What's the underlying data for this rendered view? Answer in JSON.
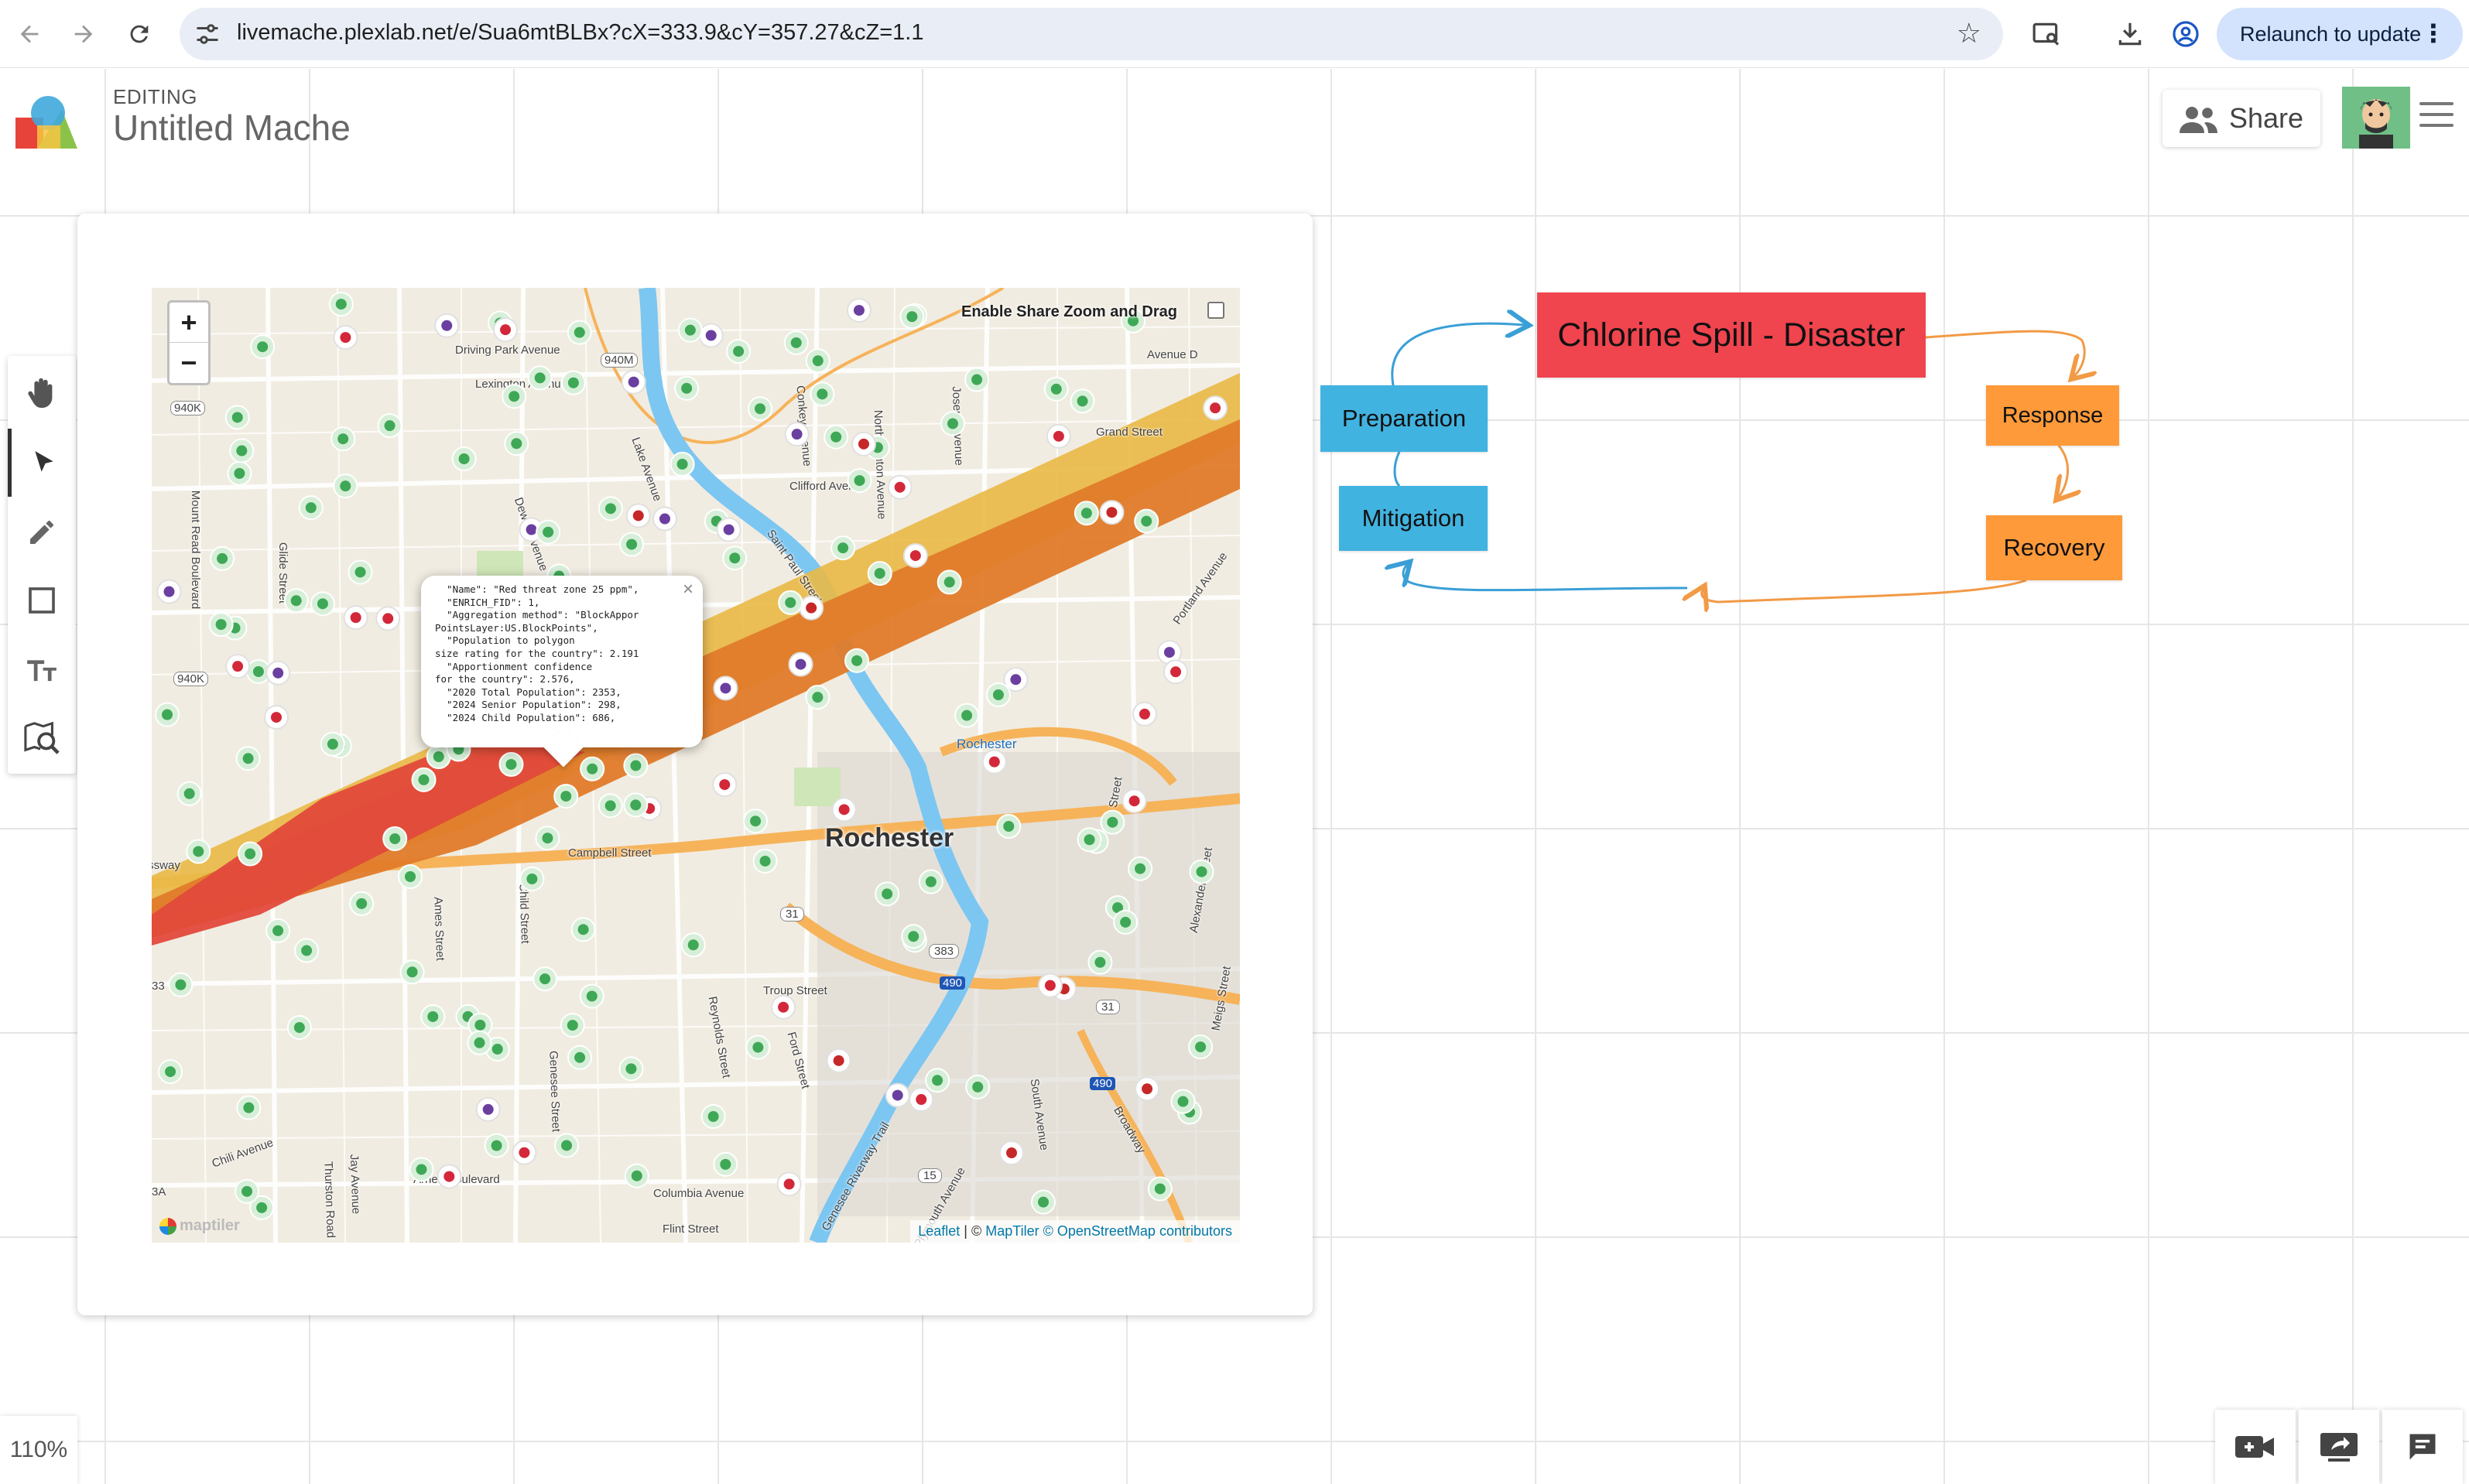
{
  "browser": {
    "url": "livemache.plexlab.net/e/Sua6mtBLBx?cX=333.9&cY=357.27&cZ=1.1",
    "relaunch_label": "Relaunch to update"
  },
  "app": {
    "mode_label": "EDITING",
    "doc_title": "Untitled Mache",
    "share_label": "Share",
    "zoom_level": "110%"
  },
  "toolbar": {
    "tools": [
      "hand-icon",
      "pointer-icon",
      "pencil-icon",
      "rectangle-icon",
      "text-icon",
      "map-search-icon"
    ],
    "active_tool": "pointer-icon"
  },
  "map": {
    "zoom_in": "+",
    "zoom_out": "−",
    "enable_share_label": "Enable Share Zoom and Drag",
    "city": "Rochester",
    "station": "Rochester",
    "attribution_leaflet": "Leaflet",
    "attribution_sep": " | © ",
    "attribution_maptiler": "MapTiler",
    "attribution_osm": "© OpenStreetMap contributors",
    "maptiler_logo": "maptiler",
    "plume_colors": {
      "outer": "#e9b945",
      "middle": "#e07b2a",
      "inner": "#e24a3b"
    },
    "streets": {
      "s1": "Driving Park Avenue",
      "s2": "Lexington Avenue",
      "s3": "Mount Read Boulevard",
      "s4": "Glide Street",
      "s5": "Dewey Avenue",
      "s6": "Lake Avenue",
      "s7": "Conkey Avenue",
      "s8": "North Clinton Avenue",
      "s9": "Joseph Avenue",
      "s10": "Clifford Avenue",
      "s11": "Saint Paul Street",
      "s12": "Avenue D",
      "s13": "Campbell Street",
      "s14": "Ames Street",
      "s15": "Child Street",
      "s16": "Troup Street",
      "s17": "Reynolds Street",
      "s18": "Ford Street",
      "s19": "Genesee Street",
      "s20": "Arnett Boulevard",
      "s21": "Columbia Avenue",
      "s22": "Flint Street",
      "s23": "Genesee Riverway Trail",
      "s24": "South Avenue",
      "s25": "Broadway",
      "s26": "Alexander Street",
      "s27": "Scio Street",
      "s28": "Meigs Street",
      "s29": "Thurston Road",
      "s30": "Chili Avenue",
      "s31": "Portland Avenue",
      "s32": "Grand Street",
      "s33": "Expressway",
      "s34": "Jay Avenue",
      "s35": "Plymouth Avenue"
    },
    "route_shields": [
      "940M",
      "940K",
      "940K",
      "31",
      "383",
      "490",
      "490",
      "31",
      "15",
      "33",
      "3A"
    ],
    "popup_text": "  \"Name\": \"Red threat zone 25 ppm\",\n  \"ENRICH_FID\": 1,\n  \"Aggregation method\": \"BlockAppor\nPointsLayer:US.BlockPoints\",\n  \"Population to polygon\nsize rating for the country\": 2.191\n  \"Apportionment confidence\nfor the country\": 2.576,\n  \"2020 Total Population\": 2353,\n  \"2024 Senior Population\": 298,\n  \"2024 Child Population\": 686,",
    "popup_close": "×"
  },
  "diagram": {
    "disaster": "Chlorine Spill - Disaster",
    "preparation": "Preparation",
    "mitigation": "Mitigation",
    "response": "Response",
    "recovery": "Recovery",
    "colors": {
      "disaster": "#f0444e",
      "phase_blue": "#41b3e0",
      "phase_orange": "#ff9a3a"
    }
  },
  "bottom_bar": {
    "buttons": [
      "video-add-icon",
      "screen-share-icon",
      "chat-icon"
    ]
  }
}
